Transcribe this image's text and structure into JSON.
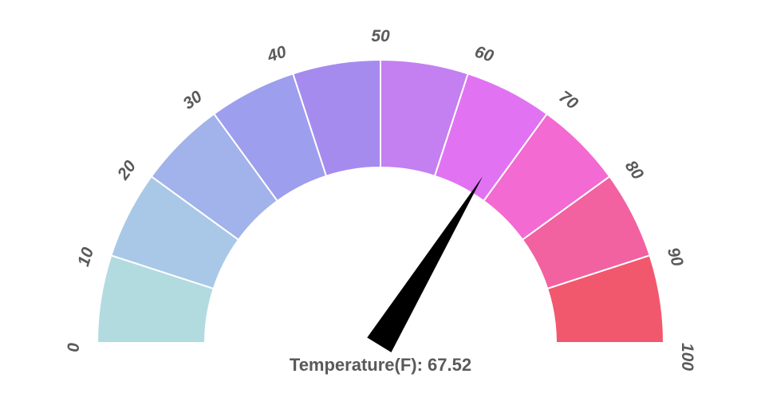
{
  "chart_data": {
    "type": "gauge",
    "min": 0,
    "max": 100,
    "value": 67.52,
    "label": "Temperature(F)",
    "ticks": [
      0,
      10,
      20,
      30,
      40,
      50,
      60,
      70,
      80,
      90,
      100
    ],
    "segment_colors": [
      "#b2dbe0",
      "#a9c8e7",
      "#a2b2ea",
      "#9d9eed",
      "#a68bef",
      "#c47ff1",
      "#e173f3",
      "#f26ad2",
      "#f261a0",
      "#f2586d"
    ]
  },
  "display": {
    "value_text": "Temperature(F): 67.52",
    "tick_labels": {
      "t0": "0",
      "t1": "10",
      "t2": "20",
      "t3": "30",
      "t4": "40",
      "t5": "50",
      "t6": "60",
      "t7": "70",
      "t8": "80",
      "t9": "90",
      "t10": "100"
    }
  }
}
